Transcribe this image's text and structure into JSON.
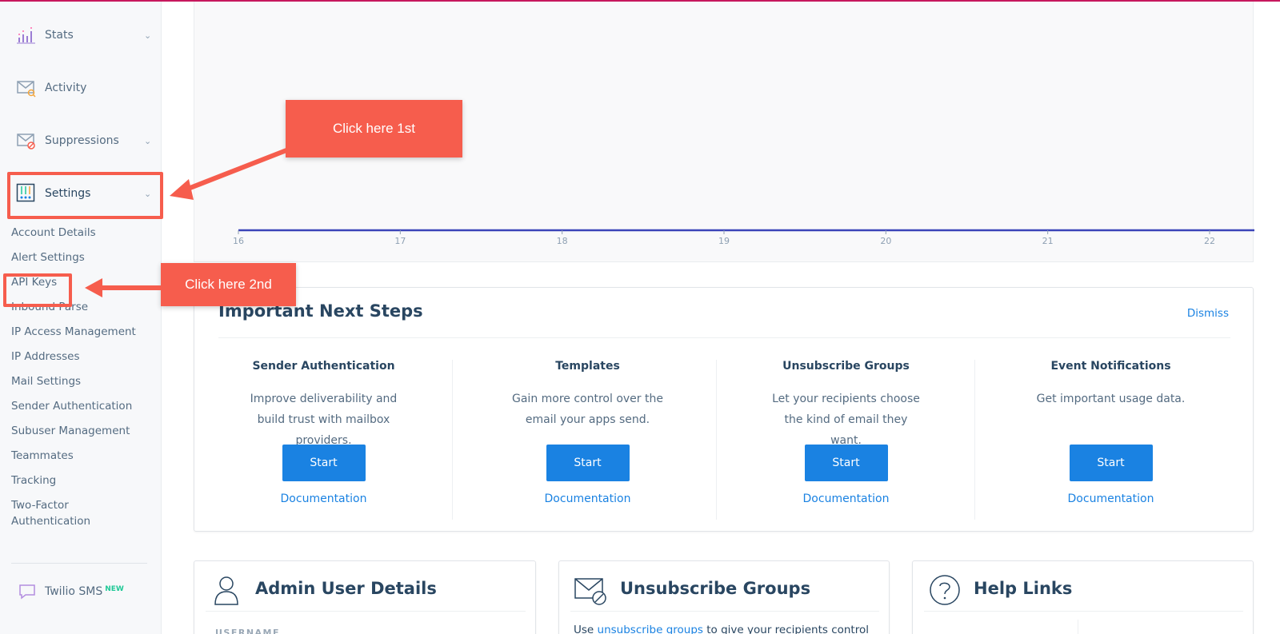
{
  "sidebar": {
    "items": [
      {
        "label": "Stats",
        "icon": "stats-icon",
        "chevron": "⌄"
      },
      {
        "label": "Activity",
        "icon": "activity-icon"
      },
      {
        "label": "Suppressions",
        "icon": "suppressions-icon",
        "chevron": "⌄"
      },
      {
        "label": "Settings",
        "icon": "settings-icon",
        "chevron": "⌄"
      }
    ],
    "settings_subitems": [
      "Account Details",
      "Alert Settings",
      "API Keys",
      "Inbound Parse",
      "IP Access Management",
      "IP Addresses",
      "Mail Settings",
      "Sender Authentication",
      "Subuser Management",
      "Teammates",
      "Tracking",
      "Two-Factor",
      "Authentication"
    ],
    "sms": {
      "label": "Twilio SMS",
      "badge": "NEW"
    }
  },
  "chart_data": {
    "type": "line",
    "x": [
      "16",
      "17",
      "18",
      "19",
      "20",
      "21",
      "22"
    ],
    "series": [
      {
        "values": [
          0,
          0,
          0,
          0,
          0,
          0,
          0
        ]
      }
    ],
    "title": "",
    "xlabel": "",
    "ylabel": "",
    "line_color": "#3b44b8"
  },
  "next_steps": {
    "title": "Important Next Steps",
    "dismiss": "Dismiss",
    "steps": [
      {
        "title": "Sender Authentication",
        "desc": "Improve deliverability and build trust with mailbox providers.",
        "button": "Start",
        "link": "Documentation"
      },
      {
        "title": "Templates",
        "desc": "Gain more control over the email your apps send.",
        "button": "Start",
        "link": "Documentation"
      },
      {
        "title": "Unsubscribe Groups",
        "desc": "Let your recipients choose the kind of email they want.",
        "button": "Start",
        "link": "Documentation"
      },
      {
        "title": "Event Notifications",
        "desc": "Get important usage data.",
        "button": "Start",
        "link": "Documentation"
      }
    ]
  },
  "cards": {
    "admin": {
      "title": "Admin User Details",
      "field_label": "USERNAME"
    },
    "unsub": {
      "title": "Unsubscribe Groups",
      "text_prefix": "Use",
      "link": "unsubscribe groups",
      "text_suffix": "to give your recipients control"
    },
    "help": {
      "title": "Help Links"
    }
  },
  "callouts": {
    "first": "Click here 1st",
    "second": "Click here 2nd"
  },
  "colors": {
    "accent": "#1a82e2",
    "callout": "#f65d4d",
    "brand_bar": "#c7185d"
  }
}
